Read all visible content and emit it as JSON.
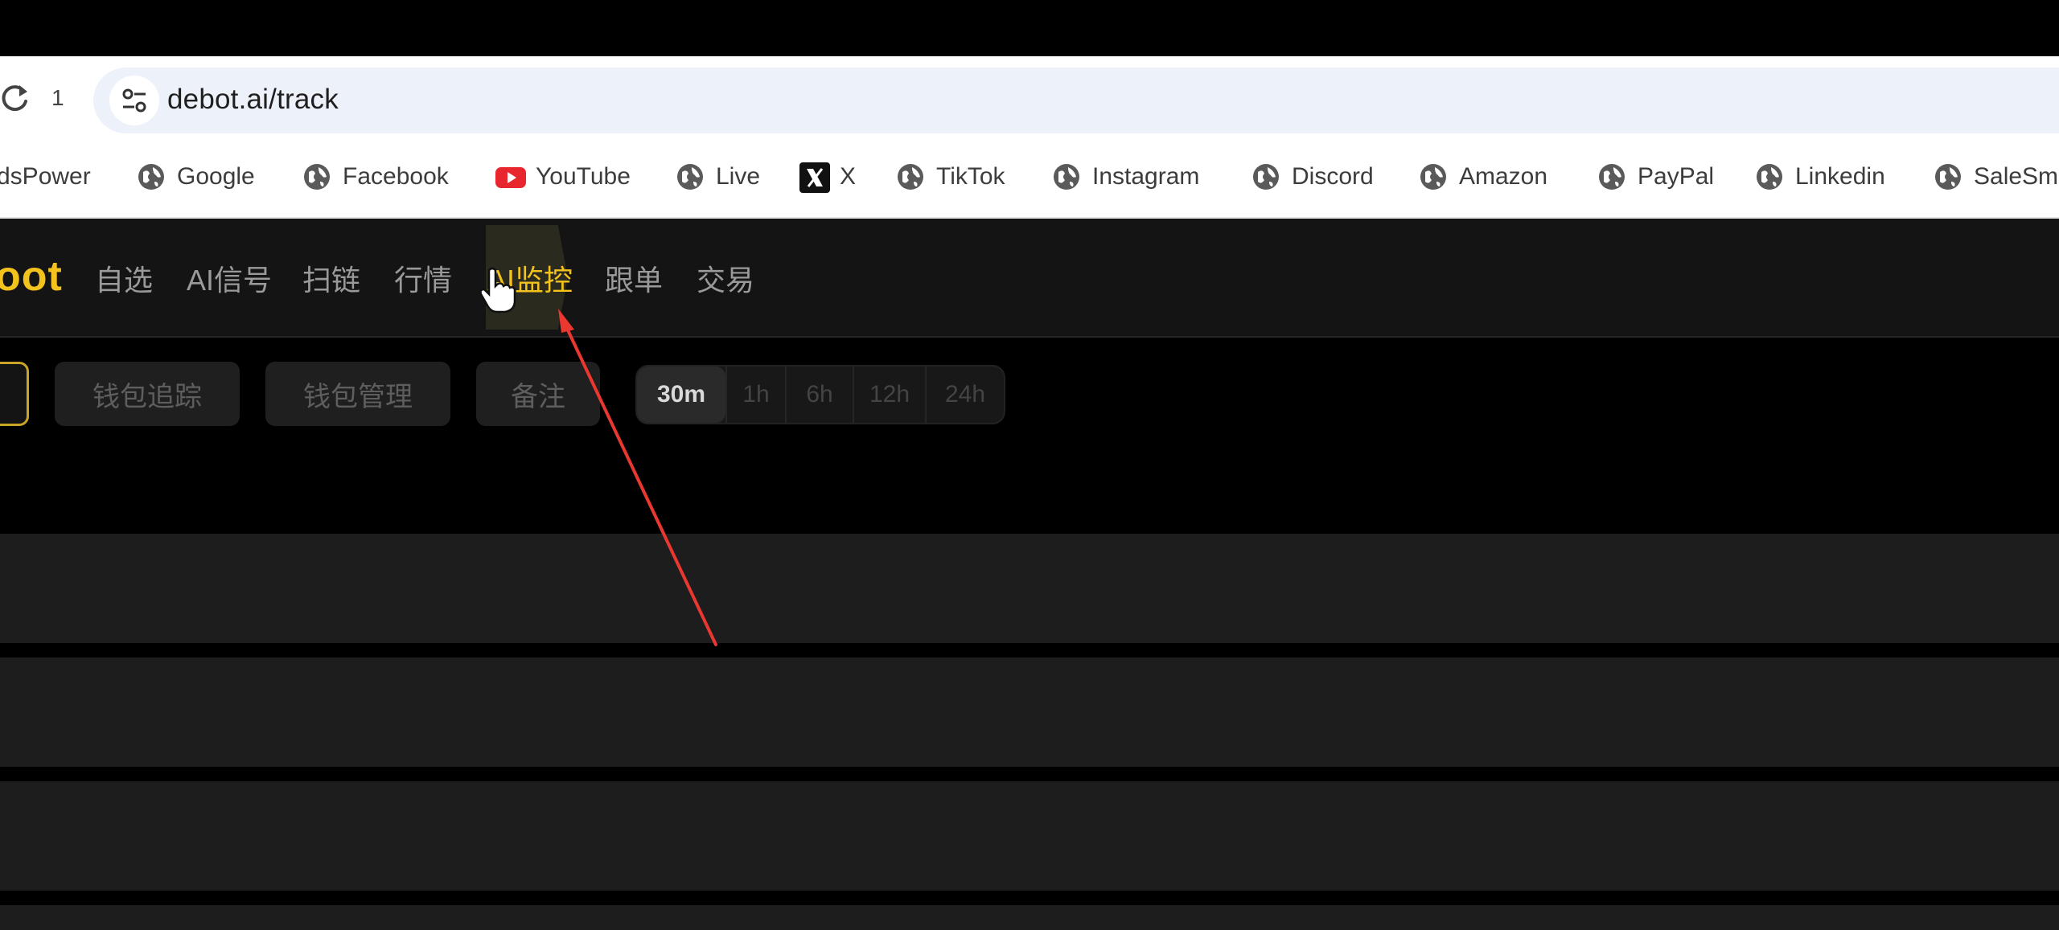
{
  "browser": {
    "tab_count": "1",
    "url": "debot.ai/track",
    "bookmarks": [
      {
        "label": "dsPower",
        "icon": "adspower-icon"
      },
      {
        "label": "Google",
        "icon": "globe-icon"
      },
      {
        "label": "Facebook",
        "icon": "globe-icon"
      },
      {
        "label": "YouTube",
        "icon": "youtube-icon"
      },
      {
        "label": "Live",
        "icon": "globe-icon"
      },
      {
        "label": "X",
        "icon": "x-logo-icon"
      },
      {
        "label": "TikTok",
        "icon": "globe-icon"
      },
      {
        "label": "Instagram",
        "icon": "globe-icon"
      },
      {
        "label": "Discord",
        "icon": "globe-icon"
      },
      {
        "label": "Amazon",
        "icon": "globe-icon"
      },
      {
        "label": "PayPal",
        "icon": "globe-icon"
      },
      {
        "label": "Linkedin",
        "icon": "globe-icon"
      },
      {
        "label": "SaleSm",
        "icon": "globe-icon"
      }
    ]
  },
  "app": {
    "logo": "oot",
    "nav": [
      {
        "label": "自选"
      },
      {
        "label": "AI信号"
      },
      {
        "label": "扫链"
      },
      {
        "label": "行情"
      },
      {
        "label": "AI监控",
        "active": true
      },
      {
        "label": "跟单"
      },
      {
        "label": "交易"
      }
    ],
    "filters": [
      {
        "label": ""
      },
      {
        "label": "钱包追踪"
      },
      {
        "label": "钱包管理"
      },
      {
        "label": "备注"
      }
    ],
    "time_ranges": [
      {
        "label": "30m",
        "active": true
      },
      {
        "label": "1h"
      },
      {
        "label": "6h"
      },
      {
        "label": "12h"
      },
      {
        "label": "24h"
      }
    ]
  },
  "colors": {
    "accent": "#f4c21c",
    "annotation_arrow": "#e8382f",
    "header_bg": "#141414",
    "row_bg": "#1d1d1d"
  }
}
